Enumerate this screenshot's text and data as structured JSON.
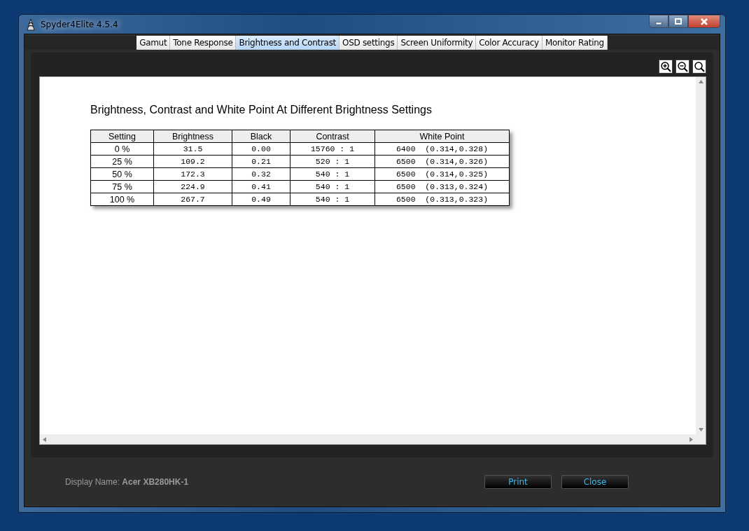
{
  "window": {
    "title": "Spyder4Elite 4.5.4"
  },
  "tabs": [
    {
      "label": "Gamut",
      "selected": false
    },
    {
      "label": "Tone Response",
      "selected": false
    },
    {
      "label": "Brightness and Contrast",
      "selected": true
    },
    {
      "label": "OSD settings",
      "selected": false
    },
    {
      "label": "Screen Uniformity",
      "selected": false
    },
    {
      "label": "Color Accuracy",
      "selected": false
    },
    {
      "label": "Monitor Rating",
      "selected": false
    }
  ],
  "report": {
    "title": "Brightness, Contrast and White Point At Different Brightness Settings",
    "table": {
      "columns": [
        "Setting",
        "Brightness",
        "Black",
        "Contrast",
        "White Point"
      ],
      "rows": [
        [
          "0 %",
          "31.5",
          "0.00",
          "15760 : 1",
          "6400  (0.314,0.328)"
        ],
        [
          "25 %",
          "109.2",
          "0.21",
          "520 : 1",
          "6500  (0.314,0.326)"
        ],
        [
          "50 %",
          "172.3",
          "0.32",
          "540 : 1",
          "6500  (0.314,0.325)"
        ],
        [
          "75 %",
          "224.9",
          "0.41",
          "540 : 1",
          "6500  (0.313,0.324)"
        ],
        [
          "100 %",
          "267.7",
          "0.49",
          "540 : 1",
          "6500  (0.313,0.323)"
        ]
      ]
    }
  },
  "footer": {
    "display_name": "Display Name: **Acer XB280HK-1**",
    "buttons": [
      "Print",
      "Close"
    ]
  }
}
